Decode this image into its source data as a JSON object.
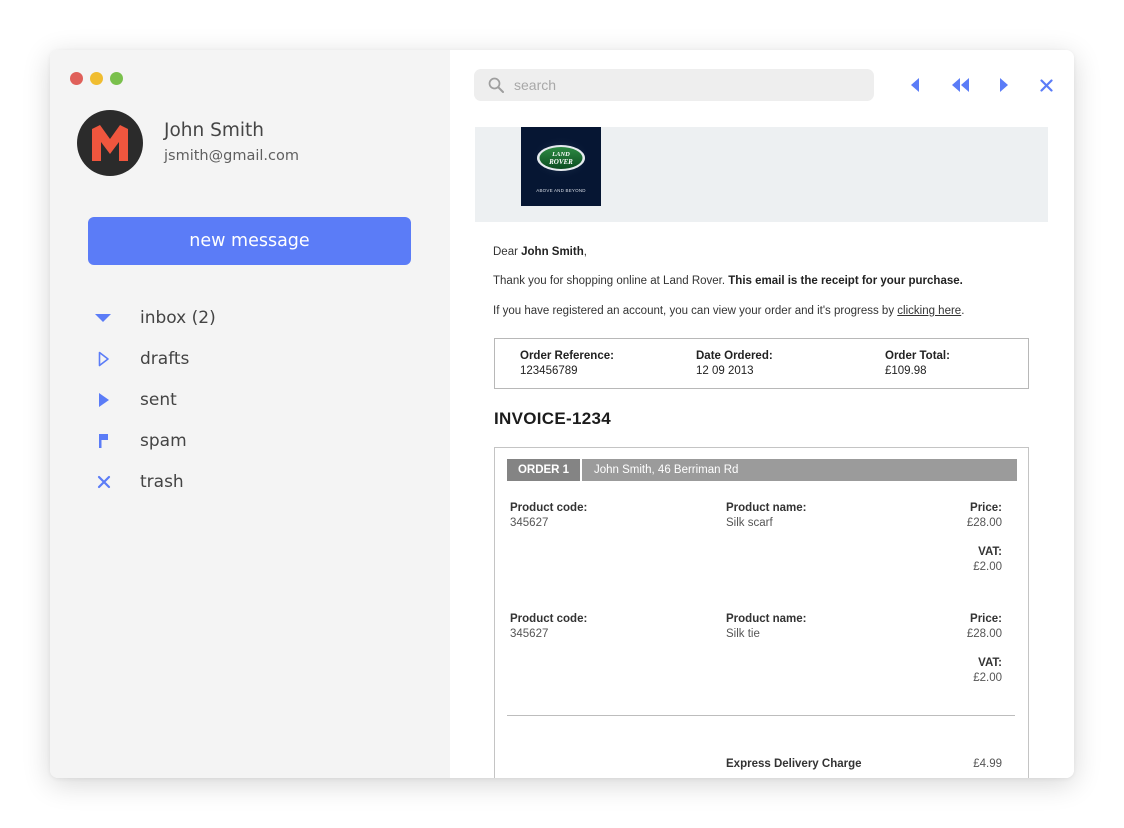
{
  "user": {
    "name": "John Smith",
    "email": "jsmith@gmail.com"
  },
  "compose": {
    "label": "new message"
  },
  "folders": [
    {
      "label": "inbox (2)",
      "icon": "triangle-down-icon"
    },
    {
      "label": "drafts",
      "icon": "triangle-right-outline-icon"
    },
    {
      "label": "sent",
      "icon": "triangle-right-icon"
    },
    {
      "label": "spam",
      "icon": "flag-icon"
    },
    {
      "label": "trash",
      "icon": "x-icon"
    }
  ],
  "search": {
    "placeholder": "search"
  },
  "colors": {
    "accent": "#5b7cf7",
    "sidebar_bg": "#f4f4f4",
    "logo_bg": "#061633",
    "order_header": "#9b9b9b"
  },
  "email": {
    "brand": {
      "line1": "LAND",
      "line2": "ROVER",
      "tagline": "ABOVE AND BEYOND"
    },
    "greeting": {
      "prefix": "Dear ",
      "name": "John Smith",
      "suffix": ","
    },
    "thanks": {
      "text": "Thank you for shopping online at Land Rover. ",
      "bold": "This email is the receipt for your purchase."
    },
    "registered": {
      "text": "If you have registered an account, you can view your order and it's progress by ",
      "link": "clicking here",
      "suffix": "."
    },
    "summary": {
      "ref_label": "Order Reference:",
      "ref_value": "123456789",
      "date_label": "Date Ordered:",
      "date_value": "12 09 2013",
      "total_label": "Order Total:",
      "total_value": "£109.98"
    },
    "invoice_title": "INVOICE-1234",
    "order": {
      "badge": "ORDER 1",
      "address": "John Smith, 46 Berriman Rd",
      "items": [
        {
          "code_label": "Product code:",
          "code": "345627",
          "name_label": "Product name:",
          "name": "Silk scarf",
          "price_label": "Price:",
          "price": "£28.00",
          "vat_label": "VAT:",
          "vat": "£2.00"
        },
        {
          "code_label": "Product code:",
          "code": "345627",
          "name_label": "Product name:",
          "name": "Silk tie",
          "price_label": "Price:",
          "price": "£28.00",
          "vat_label": "VAT:",
          "vat": "£2.00"
        }
      ],
      "delivery_label": "Express Delivery Charge",
      "delivery_value": "£4.99"
    }
  }
}
